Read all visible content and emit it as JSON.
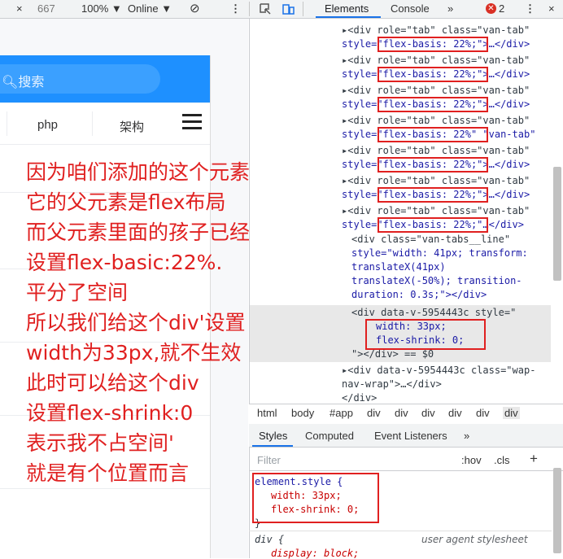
{
  "toolbar": {
    "close": "×",
    "size": "667",
    "zoom": "100% ▼",
    "network": "Online ▼",
    "rotate_icon": "⊘",
    "more_icon": "⋮",
    "tabs": [
      "Elements",
      "Console",
      "»"
    ],
    "error_count": "2",
    "settings_icon": "⋮",
    "close2": "×"
  },
  "app": {
    "search_placeholder": "搜索",
    "tabs": [
      "php",
      "架构"
    ]
  },
  "notes": [
    "因为咱们添加的这个元素",
    "它的父元素是flex布局",
    "而父元素里面的孩子已经",
    "设置flex-basic:22%.",
    "平分了空间",
    "所以我们给这个div'设置",
    "width为33px,就不生效",
    "此时可以给这个div",
    "设置flex-shrink:0",
    "表示我不占空间'",
    "就是有个位置而言"
  ],
  "elements": {
    "tab_line_1": "▸<div role=\"tab\" class=\"van-tab\"",
    "tab_line_2": "style=\"flex-basis: 22%;\">…</div>",
    "tab_line_2_partial": "style=\"flex-basis: 22%\" \"van-tab\"",
    "tab_line_8": "▸<div role=\"tab\" class=\"van-tab\"",
    "tab_line_8b": "style=\"flex-basis: 22%;\"…</div>",
    "tabs_line": [
      "<div class=\"van-tabs__line\"",
      "style=\"width: 41px; transform:",
      "translateX(41px)",
      "translateX(-50%); transition-",
      "duration: 0.3s;\"></div>"
    ],
    "selected": [
      "<div data-v-5954443c style=\"",
      "width: 33px;",
      "flex-shrink: 0;",
      "\"></div> == $0"
    ],
    "after": [
      "▸<div data-v-5954443c class=\"wap-",
      "nav-wrap\">…</div>",
      "</div>"
    ]
  },
  "breadcrumbs": [
    "html",
    "body",
    "#app",
    "div",
    "div",
    "div",
    "div",
    "div",
    "div"
  ],
  "styles_tabs": [
    "Styles",
    "Computed",
    "Event Listeners",
    "»"
  ],
  "filter": {
    "placeholder": "Filter",
    "hov": ":hov",
    "cls": ".cls",
    "plus": "+"
  },
  "styles": {
    "selector": "element.style {",
    "props": [
      "width: 33px;",
      "flex-shrink: 0;"
    ],
    "close": "}",
    "div_rule": "div {",
    "ua": "user agent stylesheet",
    "display": "display: block;"
  },
  "colors": {
    "accent": "#1e90ff",
    "annotation": "#e02020",
    "devtools_bg": "#f1f3f4"
  }
}
